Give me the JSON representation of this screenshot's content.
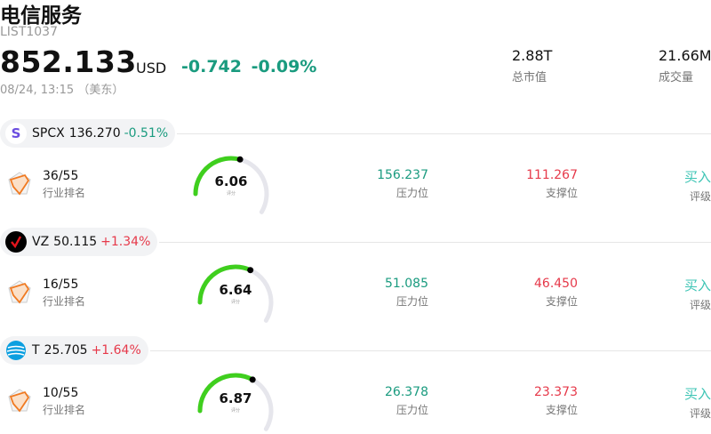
{
  "header": {
    "title": "电信服务",
    "code": "LIST1037",
    "price": "852.133",
    "currency": "USD",
    "change": "-0.742",
    "change_pct": "-0.09%",
    "timestamp": "08/24, 13:15 （美东）",
    "market_cap_value": "2.88T",
    "market_cap_label": "总市值",
    "volume_value": "21.66M",
    "volume_label": "成交量"
  },
  "labels": {
    "rank": "行业排名",
    "resistance": "压力位",
    "support": "支撑位",
    "rating": "评级",
    "score": "评分"
  },
  "colors": {
    "up": "#e6394a",
    "down": "#1a9b7f",
    "rating": "#3cc4b4",
    "gauge": "#3fcf1e"
  },
  "stocks": [
    {
      "symbol": "SPCX",
      "price": "136.270",
      "change_pct": "-0.51%",
      "direction": "down",
      "logo_icon": "s-letter-icon",
      "rank": "36/55",
      "score": 6.06,
      "score_text": "6.06",
      "resistance": "156.237",
      "support": "111.267",
      "rating": "买入"
    },
    {
      "symbol": "VZ",
      "price": "50.115",
      "change_pct": "+1.34%",
      "direction": "up",
      "logo_icon": "verizon-check-icon",
      "rank": "16/55",
      "score": 6.64,
      "score_text": "6.64",
      "resistance": "51.085",
      "support": "46.450",
      "rating": "买入"
    },
    {
      "symbol": "T",
      "price": "25.705",
      "change_pct": "+1.64%",
      "direction": "up",
      "logo_icon": "att-globe-icon",
      "rank": "10/55",
      "score": 6.87,
      "score_text": "6.87",
      "resistance": "26.378",
      "support": "23.373",
      "rating": "买入"
    }
  ]
}
